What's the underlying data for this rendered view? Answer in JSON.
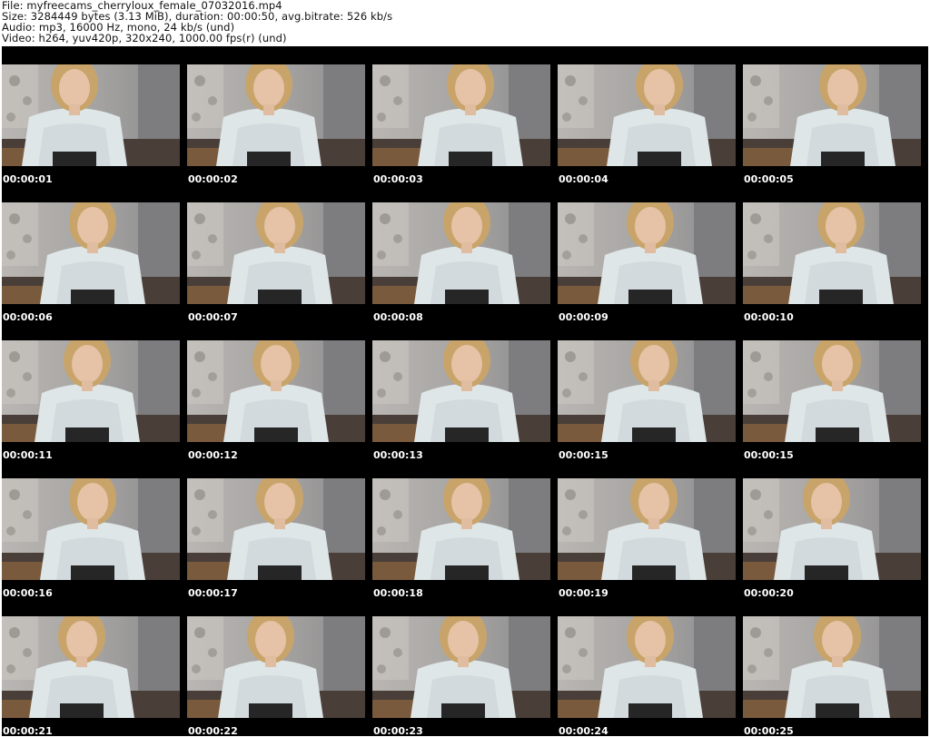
{
  "header": {
    "file_line": "File: myfreecams_cherryloux_female_07032016.mp4",
    "size_line": "Size: 3284449 bytes (3.13 MiB), duration: 00:00:50, avg.bitrate: 526 kb/s",
    "audio_line": "Audio: mp3, 16000 Hz, mono, 24 kb/s (und)",
    "video_line": "Video: h264, yuv420p, 320x240, 1000.00 fps(r) (und)"
  },
  "thumbnails": [
    {
      "timestamp": "00:00:01"
    },
    {
      "timestamp": "00:00:02"
    },
    {
      "timestamp": "00:00:03"
    },
    {
      "timestamp": "00:00:04"
    },
    {
      "timestamp": "00:00:05"
    },
    {
      "timestamp": "00:00:06"
    },
    {
      "timestamp": "00:00:07"
    },
    {
      "timestamp": "00:00:08"
    },
    {
      "timestamp": "00:00:09"
    },
    {
      "timestamp": "00:00:10"
    },
    {
      "timestamp": "00:00:11"
    },
    {
      "timestamp": "00:00:12"
    },
    {
      "timestamp": "00:00:13"
    },
    {
      "timestamp": "00:00:15"
    },
    {
      "timestamp": "00:00:15"
    },
    {
      "timestamp": "00:00:16"
    },
    {
      "timestamp": "00:00:17"
    },
    {
      "timestamp": "00:00:18"
    },
    {
      "timestamp": "00:00:19"
    },
    {
      "timestamp": "00:00:20"
    },
    {
      "timestamp": "00:00:21"
    },
    {
      "timestamp": "00:00:22"
    },
    {
      "timestamp": "00:00:23"
    },
    {
      "timestamp": "00:00:24"
    },
    {
      "timestamp": "00:00:25"
    }
  ],
  "colors": {
    "sheet_background": "#000000",
    "timestamp_text": "#ffffff",
    "header_text": "#111111"
  }
}
